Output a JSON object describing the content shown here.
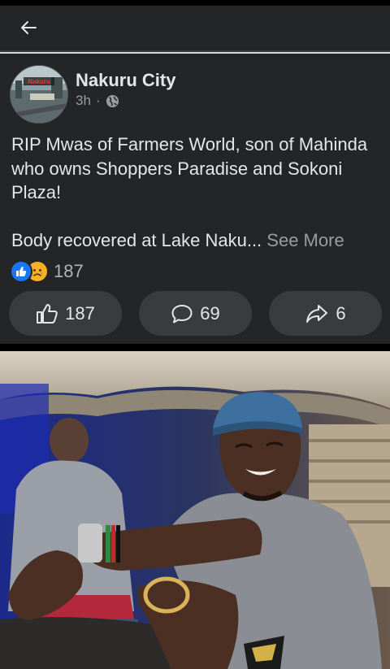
{
  "header": {
    "back_icon": "arrow-left-icon"
  },
  "post": {
    "page_name": "Nakuru City",
    "time": "3h",
    "separator": "·",
    "privacy_icon": "globe-icon",
    "avatar_text": "Nakuru",
    "text_line1": "RIP Mwas of Farmers World, son of Mahinda who owns Shoppers Paradise and Sokoni Plaza!",
    "text_line2": "Body  recovered at Lake Naku...",
    "see_more": "See More",
    "reaction_total": "187",
    "reaction_icons": [
      "like-icon",
      "sad-icon"
    ]
  },
  "actions": {
    "like_count": "187",
    "comment_count": "69",
    "share_count": "6"
  },
  "colors": {
    "card_bg": "#242526",
    "button_bg": "#3a3b3c",
    "text": "#e4e6eb",
    "secondary_text": "#9a9ca0",
    "like_blue": "#1877f2",
    "sad_yellow": "#f7b125"
  }
}
